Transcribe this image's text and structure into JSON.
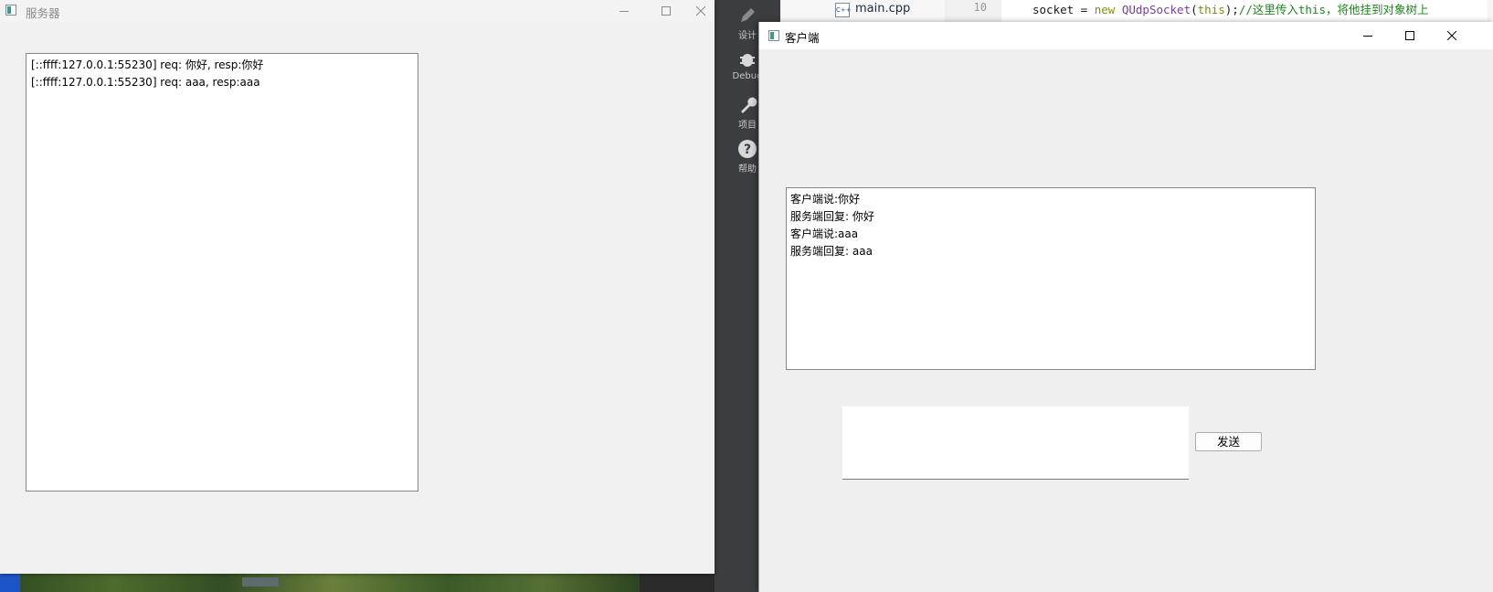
{
  "server_window": {
    "title": "服务器",
    "log": [
      "[::ffff:127.0.0.1:55230] req: 你好, resp:你好",
      "[::ffff:127.0.0.1:55230] req: aaa, resp:aaa"
    ]
  },
  "client_window": {
    "title": "客户端",
    "log": [
      "客户端说:你好",
      "服务端回复: 你好",
      "客户端说:aaa",
      "服务端回复: aaa"
    ],
    "input_value": "",
    "send_label": "发送"
  },
  "ide": {
    "modes": [
      {
        "label": "设计",
        "icon": "pencil-icon"
      },
      {
        "label": "Debug",
        "icon": "bug-icon"
      },
      {
        "label": "项目",
        "icon": "wrench-icon"
      },
      {
        "label": "帮助",
        "icon": "help-icon"
      }
    ],
    "open_file": "main.cpp",
    "line_number": "10",
    "code_line": {
      "a": "socket = ",
      "b": "new ",
      "c": "QUdpSocket",
      "d": "(",
      "e": "this",
      "f": ");",
      "g": "//这里传入this，将他挂到对象树上"
    }
  },
  "colors": {
    "ide_sidebar": "#3c3d40",
    "window_bg": "#f0f0f0",
    "keyword": "#8c8c00",
    "class_name": "#7a3ca8",
    "comment": "#1a8a1a"
  }
}
